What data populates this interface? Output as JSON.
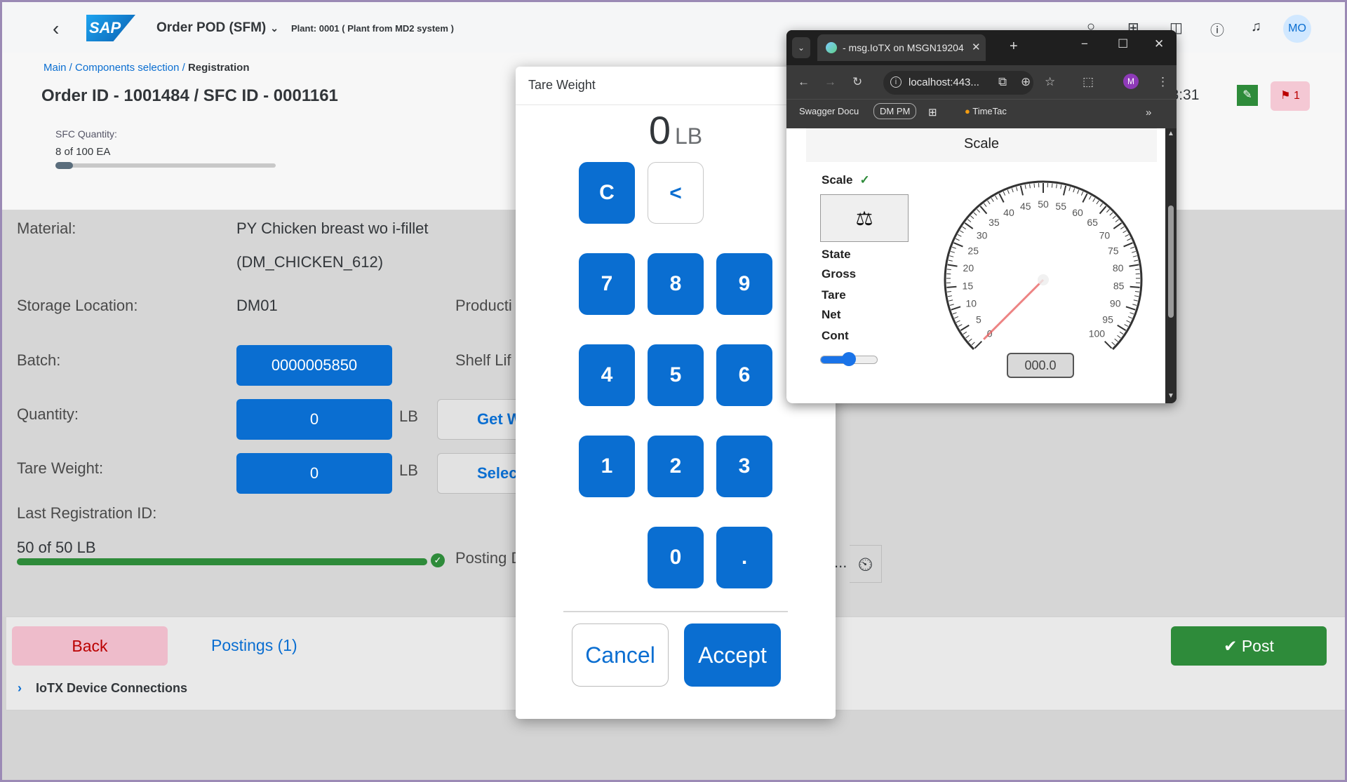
{
  "shell": {
    "app_title": "Order POD (SFM)",
    "plant": "Plant: 0001 ( Plant from MD2 system )",
    "avatar_initials": "MO",
    "logo_text": "SAP"
  },
  "header": {
    "breadcrumb": [
      "Main /",
      "Components selection /",
      "Registration"
    ],
    "title": "Order ID - 1001484 / SFC ID - 0001161",
    "sfc_quantity_label": "SFC Quantity:",
    "sfc_quantity_value": "8 of 100 EA",
    "sfc_progress_fraction": 0.08,
    "time_partial": ":18:31",
    "notification_count": "1"
  },
  "form": {
    "material_label": "Material:",
    "material_value_line1": "PY Chicken breast wo i-fillet",
    "material_value_line2": "(DM_CHICKEN_612)",
    "storage_label": "Storage Location:",
    "storage_value": "DM01",
    "production_label_partial": "Producti",
    "batch_label": "Batch:",
    "batch_value": "0000005850",
    "shelf_label_partial": "Shelf Lif",
    "quantity_label": "Quantity:",
    "quantity_value": "0",
    "quantity_unit": "LB",
    "get_weight_partial": "Get W",
    "tare_label": "Tare Weight:",
    "tare_value": "0",
    "tare_unit": "LB",
    "select_partial": "Selec",
    "last_reg_label": "Last Registration ID:",
    "last_reg_value": "50 of 50 LB",
    "last_reg_progress_fraction": 1.0,
    "posting_label_partial": "Posting D",
    "date_partial": "..."
  },
  "footer": {
    "back_label": "Back",
    "postings_label": "Postings (1)",
    "post_label": "Post",
    "iotx_label": "IoTX Device Connections"
  },
  "dialog": {
    "title": "Tare Weight",
    "display_value": "0",
    "display_unit": "LB",
    "keys": {
      "clear": "C",
      "backspace": "<",
      "k7": "7",
      "k8": "8",
      "k9": "9",
      "k4": "4",
      "k5": "5",
      "k6": "6",
      "k1": "1",
      "k2": "2",
      "k3": "3",
      "k0": "0",
      "dot": "."
    },
    "cancel_label": "Cancel",
    "accept_label": "Accept"
  },
  "browser": {
    "tab_title": "- msg.IoTX on MSGN19204",
    "url": "localhost:443...",
    "profile_initial": "M",
    "bookmarks": [
      "Swagger Docu",
      "DM PM",
      "TimeTac"
    ],
    "page": {
      "header": "Scale",
      "scale_label": "Scale",
      "scale_ok": "✓",
      "rows": [
        "State",
        "Gross",
        "Tare",
        "Net",
        "Cont"
      ],
      "gauge_ticks": [
        "0",
        "5",
        "10",
        "15",
        "20",
        "25",
        "30",
        "35",
        "40",
        "45",
        "50",
        "55",
        "60",
        "65",
        "70",
        "75",
        "80",
        "85",
        "90",
        "95",
        "100"
      ],
      "gauge_min": 0,
      "gauge_max": 100,
      "gauge_value": 0,
      "readout": "000.0",
      "cont_slider_fraction": 0.5
    }
  }
}
